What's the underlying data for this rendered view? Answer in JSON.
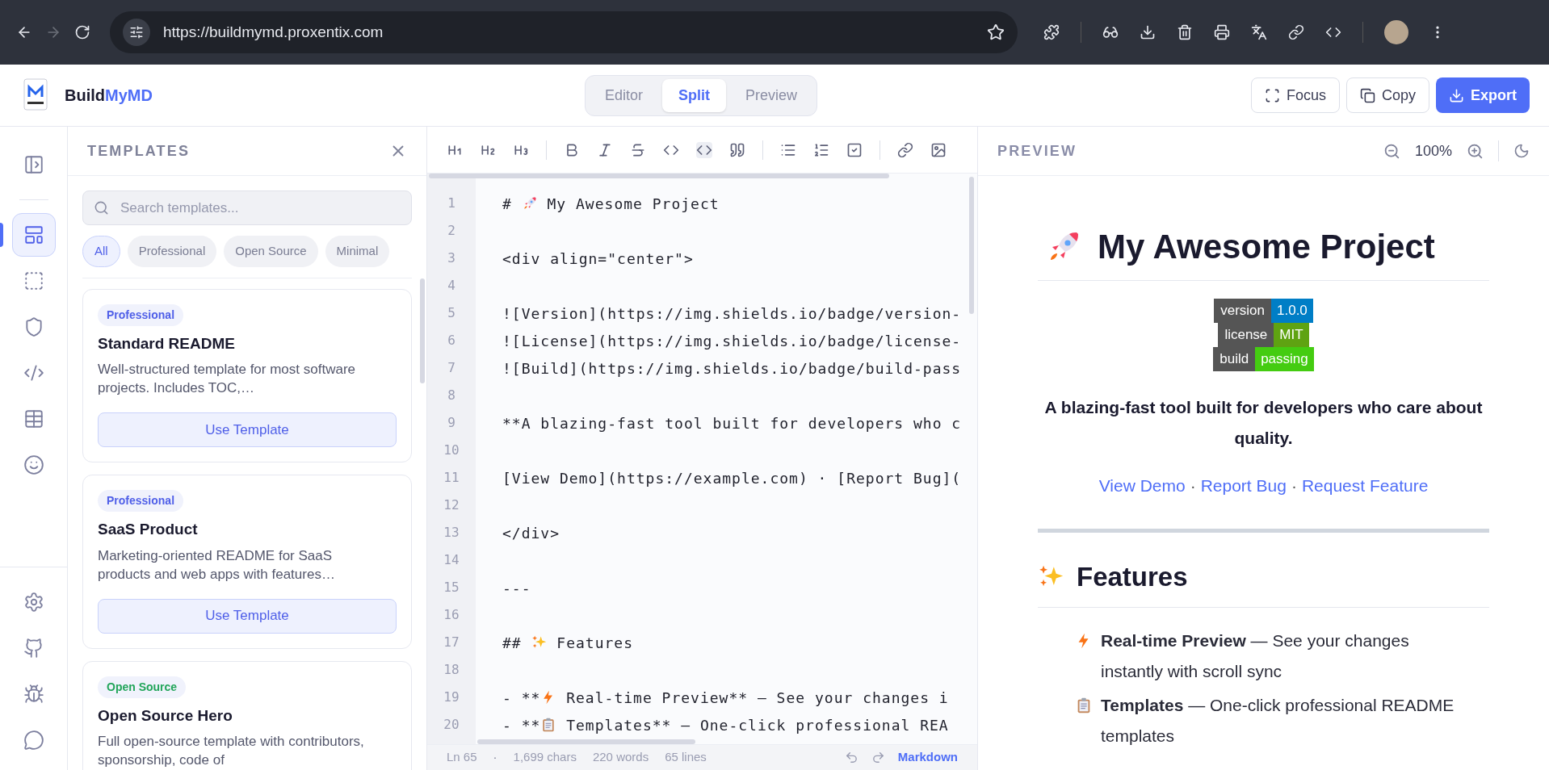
{
  "browser": {
    "url": "https://buildmymd.proxentix.com",
    "forward_disabled": true
  },
  "app": {
    "brand": {
      "first": "Build",
      "accent": "MyMD"
    },
    "view_tabs": [
      {
        "label": "Editor",
        "selected": false
      },
      {
        "label": "Split",
        "selected": true
      },
      {
        "label": "Preview",
        "selected": false
      }
    ],
    "actions": [
      {
        "label": "Focus",
        "kind": "focus"
      },
      {
        "label": "Copy",
        "kind": "copy"
      },
      {
        "label": "Export",
        "kind": "export"
      }
    ]
  },
  "rail": {
    "top": [
      {
        "selected": false
      },
      {
        "selected": true
      },
      {
        "selected": false
      },
      {
        "selected": false
      },
      {
        "selected": false
      },
      {
        "selected": false
      },
      {
        "selected": false
      }
    ],
    "bottom": [
      {
        "selected": false
      },
      {
        "selected": false
      },
      {
        "selected": false
      },
      {
        "selected": false
      }
    ]
  },
  "templates": {
    "title": "TEMPLATES",
    "search": {
      "placeholder": "Search templates..."
    },
    "filters": [
      {
        "label": "All",
        "selected": true
      },
      {
        "label": "Professional",
        "selected": false
      },
      {
        "label": "Open Source",
        "selected": false
      },
      {
        "label": "Minimal",
        "selected": false
      }
    ],
    "cards": [
      {
        "tag": "Professional",
        "color": "#4f5fe8",
        "title": "Standard README",
        "description": "Well-structured template for most software projects. Includes TOC,…",
        "button": "Use Template"
      },
      {
        "tag": "Professional",
        "color": "#4f5fe8",
        "title": "SaaS Product",
        "description": "Marketing-oriented README for SaaS products and web apps with features…",
        "button": "Use Template"
      },
      {
        "tag": "Open Source",
        "color": "#22a55a",
        "title": "Open Source Hero",
        "description": "Full open-source template with contributors, sponsorship, code of"
      }
    ]
  },
  "editor": {
    "lines": [
      {
        "number": "1",
        "before": "# ",
        "after": " My Awesome Project"
      },
      {
        "number": "2"
      },
      {
        "number": "3",
        "text": "<div align=\"center\">"
      },
      {
        "number": "4"
      },
      {
        "number": "5",
        "text": "![Version](https://img.shields.io/badge/version-"
      },
      {
        "number": "6",
        "text": "![License](https://img.shields.io/badge/license-"
      },
      {
        "number": "7",
        "text": "![Build](https://img.shields.io/badge/build-pass"
      },
      {
        "number": "8"
      },
      {
        "number": "9",
        "text": "**A blazing-fast tool built for developers who c"
      },
      {
        "number": "10"
      },
      {
        "number": "11",
        "text": "[View Demo](https://example.com) · [Report Bug]("
      },
      {
        "number": "12"
      },
      {
        "number": "13",
        "text": "</div>"
      },
      {
        "number": "14"
      },
      {
        "number": "15",
        "text": "---"
      },
      {
        "number": "16"
      },
      {
        "number": "17",
        "before": "## ",
        "after": " Features"
      },
      {
        "number": "18"
      },
      {
        "number": "19",
        "before": "- **",
        "after": " Real-time Preview** — See your changes i"
      },
      {
        "number": "20",
        "before": "- **",
        "after": " Templates** — One-click professional REA"
      }
    ],
    "status": {
      "line": "Ln 65",
      "separator": "·",
      "chars": "1,699 chars",
      "words": "220 words",
      "lines": "65 lines",
      "mode": "Markdown"
    }
  },
  "preview": {
    "title": "PREVIEW",
    "zoom": "100%",
    "heading": "My Awesome Project",
    "badges": [
      {
        "label": "version",
        "value": "1.0.0",
        "color": "#007ec6"
      },
      {
        "label": "license",
        "value": "MIT",
        "color": "#5fa312"
      },
      {
        "label": "build",
        "value": "passing",
        "color": "#44cc11"
      }
    ],
    "tagline": "A blazing-fast tool built for developers who care about quality.",
    "links": [
      {
        "label": "View Demo"
      },
      {
        "label": "Report Bug"
      },
      {
        "label": "Request Feature"
      }
    ],
    "link_separator": "·",
    "section": "Features",
    "features": [
      {
        "text": "**Real-time Preview** — See your changes instantly with scroll sync"
      },
      {
        "text": "**Templates** — One-click professional README templates"
      }
    ]
  }
}
